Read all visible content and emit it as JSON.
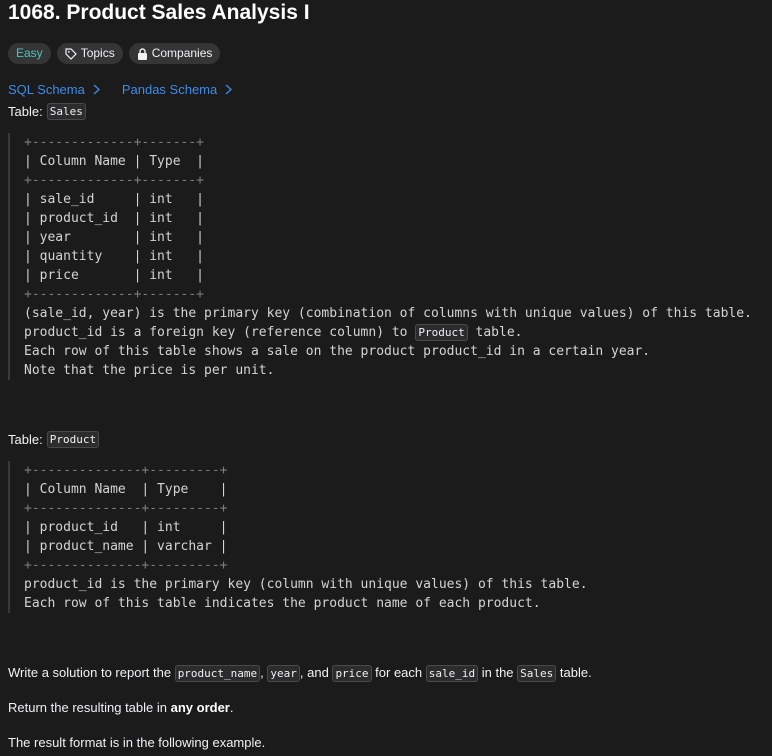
{
  "problem": {
    "title": "1068. Product Sales Analysis I",
    "difficulty": "Easy",
    "topics_label": "Topics",
    "companies_label": "Companies"
  },
  "schema_links": [
    "SQL Schema",
    "Pandas Schema"
  ],
  "sales": {
    "label": "Table:",
    "name": "Sales",
    "lines": [
      "+-------------+-------+",
      "| Column Name | Type  |",
      "+-------------+-------+",
      "| sale_id     | int   |",
      "| product_id  | int   |",
      "| year        | int   |",
      "| quantity    | int   |",
      "| price       | int   |",
      "+-------------+-------+"
    ],
    "notes": {
      "n1": "(sale_id, year) is the primary key (combination of columns with unique values) of this table.",
      "n2_prefix": "product_id is a foreign key (reference column) to ",
      "n2_code": "Product",
      "n2_suffix": " table.",
      "n3": "Each row of this table shows a sale on the product product_id in a certain year.",
      "n4": "Note that the price is per unit."
    }
  },
  "product": {
    "label": "Table:",
    "name": "Product",
    "lines": [
      "+--------------+---------+",
      "| Column Name  | Type    |",
      "+--------------+---------+",
      "| product_id   | int     |",
      "| product_name | varchar |",
      "+--------------+---------+"
    ],
    "notes": {
      "n1": "product_id is the primary key (column with unique values) of this table.",
      "n2": "Each row of this table indicates the product name of each product."
    }
  },
  "instructions": {
    "p1": {
      "t1": "Write a solution to report the ",
      "c1": "product_name",
      "t2": ", ",
      "c2": "year",
      "t3": ", and ",
      "c3": "price",
      "t4": " for each ",
      "c4": "sale_id",
      "t5": " in the ",
      "c5": "Sales",
      "t6": " table."
    },
    "p2": {
      "t1": "Return the resulting table in ",
      "b1": "any order",
      "t2": "."
    },
    "p3": "The result format is in the following example."
  }
}
